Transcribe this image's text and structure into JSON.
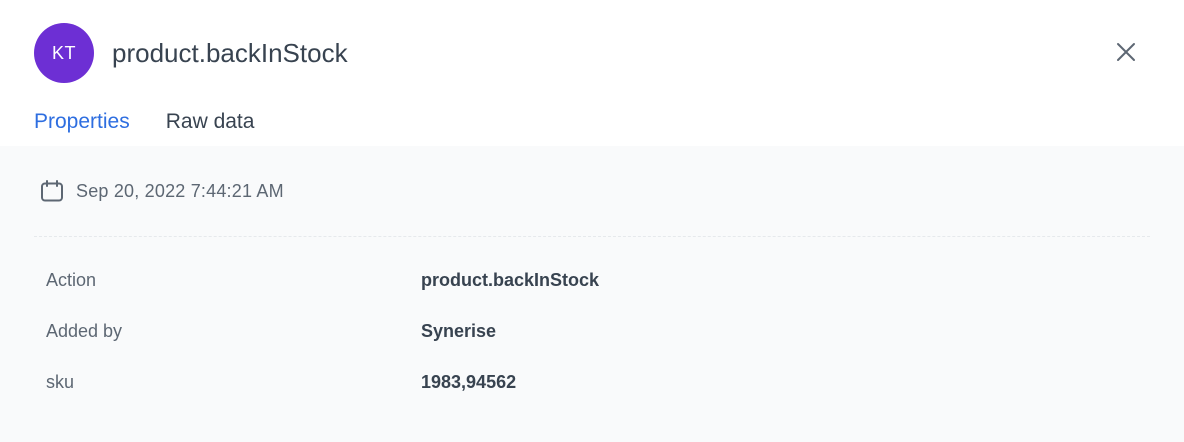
{
  "header": {
    "avatar_initials": "KT",
    "avatar_color": "#6d2fd4",
    "title": "product.backInStock",
    "close_icon": "close-icon"
  },
  "tabs": [
    {
      "label": "Properties",
      "active": true
    },
    {
      "label": "Raw data",
      "active": false
    }
  ],
  "accent_color": "#2e6ee0",
  "event": {
    "timestamp_icon": "calendar-icon",
    "timestamp": "Sep 20, 2022 7:44:21 AM"
  },
  "properties": [
    {
      "label": "Action",
      "value": "product.backInStock"
    },
    {
      "label": "Added by",
      "value": "Synerise"
    },
    {
      "label": "sku",
      "value": "1983,94562"
    }
  ]
}
